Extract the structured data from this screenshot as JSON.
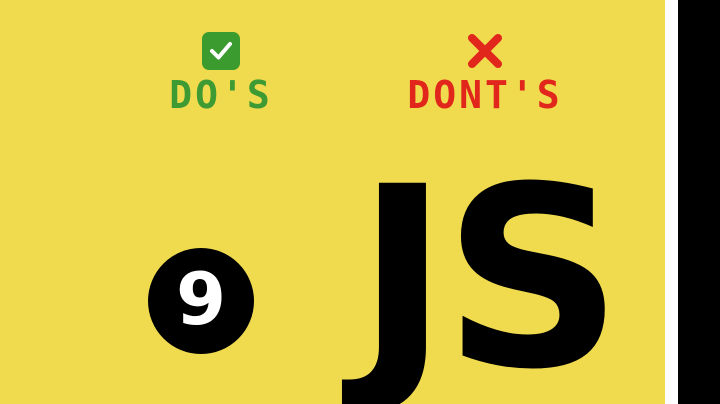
{
  "colors": {
    "background": "#F0DB4F",
    "do_green": "#3E9A32",
    "dont_red": "#E1261C",
    "badge": "#000000",
    "badge_text": "#FFFFFF"
  },
  "dos": {
    "icon": "check-mark-icon",
    "label": "DO'S"
  },
  "donts": {
    "icon": "cross-mark-icon",
    "label": "DONT'S"
  },
  "badge": {
    "number": "9"
  },
  "logo": {
    "text": "JS"
  }
}
